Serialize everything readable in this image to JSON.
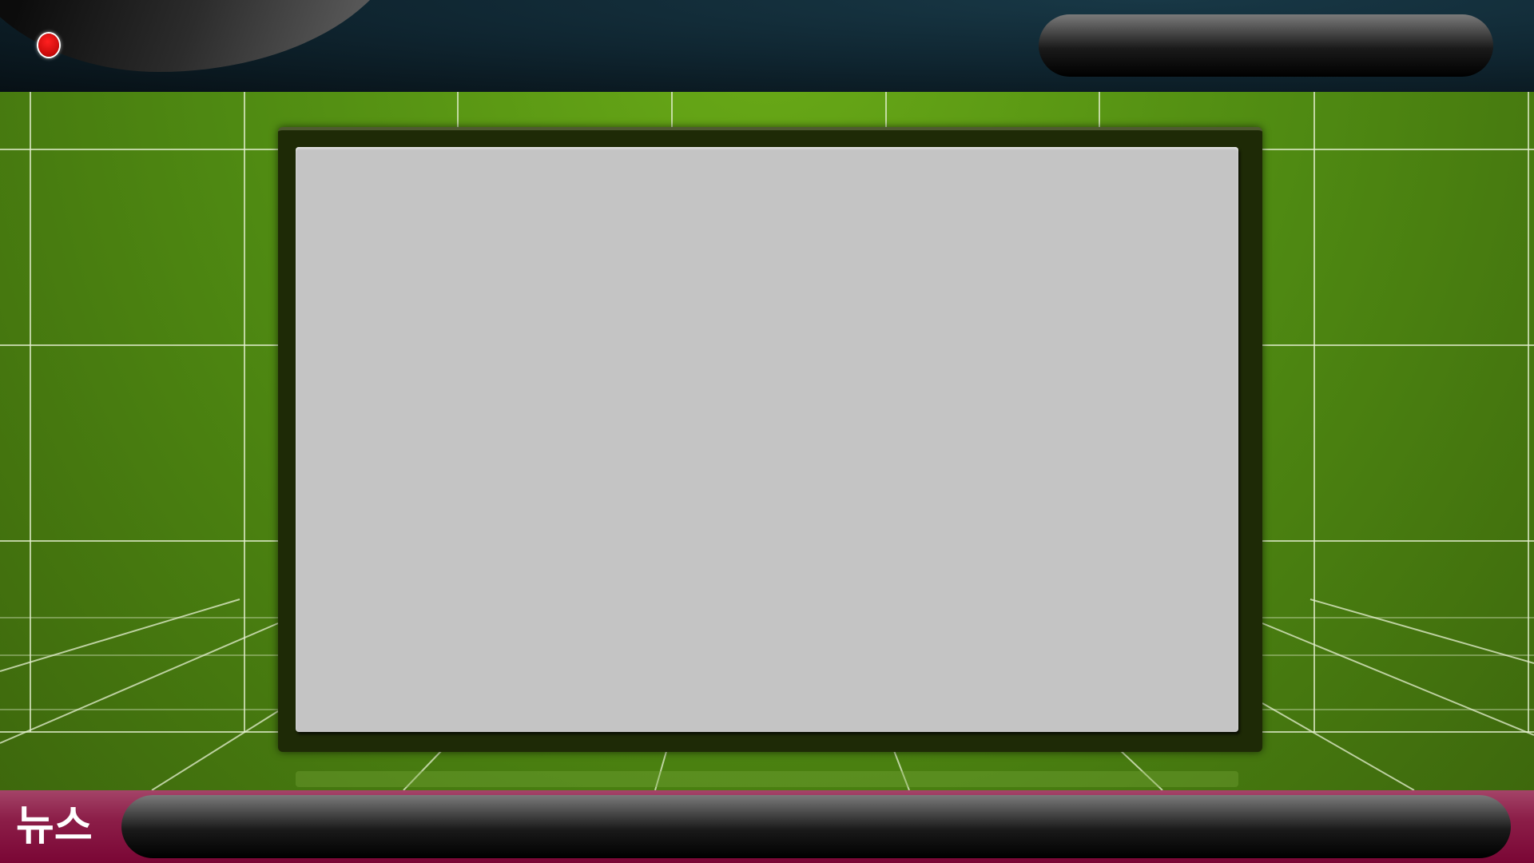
{
  "lower_third": {
    "label": "뉴스",
    "ticker_text": ""
  },
  "top_bar": {
    "title_text": "",
    "recording_indicator": "red-dot-icon"
  },
  "colors": {
    "background": "#5a9414",
    "top_bar": "#0f2530",
    "lower_third": "#8c1e48",
    "screen": "#c4c4c4",
    "rec": "#e00000"
  }
}
